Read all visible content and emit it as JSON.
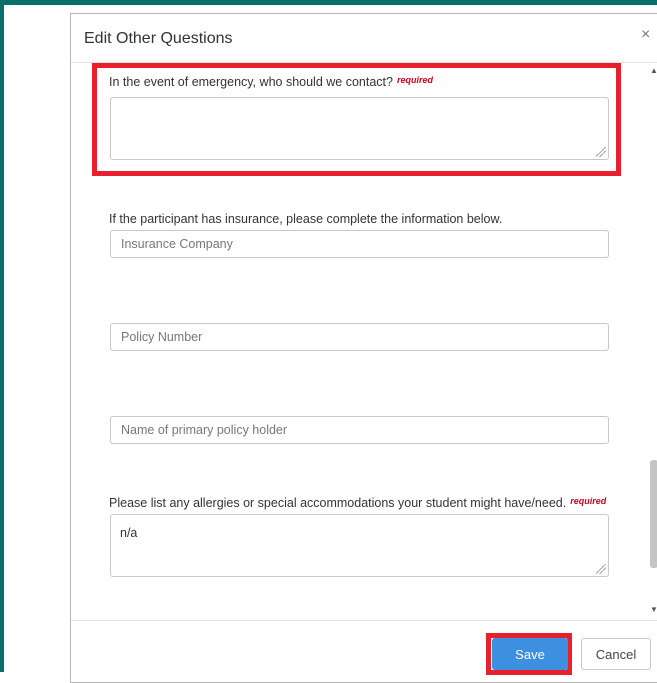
{
  "modal": {
    "title": "Edit Other Questions",
    "close_icon": "×"
  },
  "fields": {
    "emergency": {
      "label": "In the event of emergency, who should we contact?",
      "required": "required",
      "value": ""
    },
    "insurance_intro": "If the participant has insurance, please complete the information below.",
    "insurance_company": {
      "placeholder": "Insurance Company"
    },
    "policy_number": {
      "placeholder": "Policy Number"
    },
    "policy_holder": {
      "placeholder": "Name of primary policy holder"
    },
    "allergies": {
      "label": "Please list any allergies or special accommodations your student might have/need.",
      "required": "required",
      "value": "n/a"
    }
  },
  "footer": {
    "save_label": "Save",
    "cancel_label": "Cancel"
  },
  "colors": {
    "accent": "#0a6f6a",
    "highlight": "#e8202e",
    "primary_button": "#3d8fe0",
    "required_text": "#d0021b"
  }
}
